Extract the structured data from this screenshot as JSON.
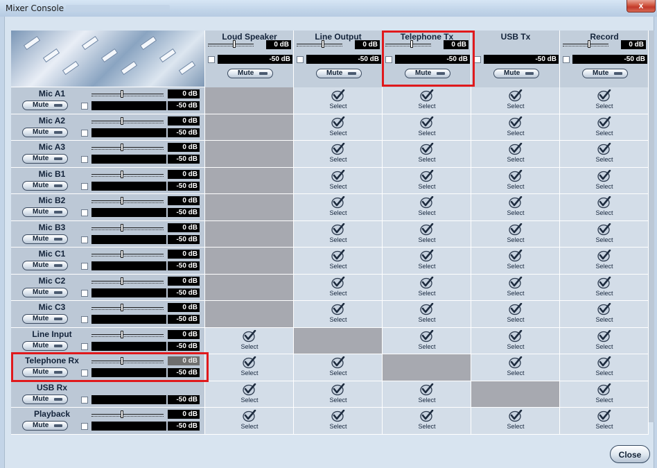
{
  "window": {
    "title": "Mixer Console",
    "close_glyph": "x"
  },
  "outputs": [
    {
      "name": "Loud Speaker",
      "gain": "0 dB",
      "level": "-50 dB",
      "mute": "Mute"
    },
    {
      "name": "Line Output",
      "gain": "0 dB",
      "level": "-50 dB",
      "mute": "Mute"
    },
    {
      "name": "Telephone Tx",
      "gain": "0 dB",
      "level": "-50 dB",
      "mute": "Mute"
    },
    {
      "name": "USB Tx",
      "gain": "",
      "level": "-50 dB",
      "mute": "Mute"
    },
    {
      "name": "Record",
      "gain": "0 dB",
      "level": "-50 dB",
      "mute": "Mute"
    }
  ],
  "inputs": [
    {
      "name": "Mic A1",
      "gain": "0 dB",
      "level": "-50 dB",
      "mute": "Mute"
    },
    {
      "name": "Mic A2",
      "gain": "0 dB",
      "level": "-50 dB",
      "mute": "Mute"
    },
    {
      "name": "Mic A3",
      "gain": "0 dB",
      "level": "-50 dB",
      "mute": "Mute"
    },
    {
      "name": "Mic B1",
      "gain": "0 dB",
      "level": "-50 dB",
      "mute": "Mute"
    },
    {
      "name": "Mic B2",
      "gain": "0 dB",
      "level": "-50 dB",
      "mute": "Mute"
    },
    {
      "name": "Mic B3",
      "gain": "0 dB",
      "level": "-50 dB",
      "mute": "Mute"
    },
    {
      "name": "Mic C1",
      "gain": "0 dB",
      "level": "-50 dB",
      "mute": "Mute"
    },
    {
      "name": "Mic C2",
      "gain": "0 dB",
      "level": "-50 dB",
      "mute": "Mute"
    },
    {
      "name": "Mic C3",
      "gain": "0 dB",
      "level": "-50 dB",
      "mute": "Mute"
    },
    {
      "name": "Line Input",
      "gain": "0 dB",
      "level": "-50 dB",
      "mute": "Mute"
    },
    {
      "name": "Telephone Rx",
      "gain": "0 dB",
      "level": "-50 dB",
      "mute": "Mute"
    },
    {
      "name": "USB Rx",
      "gain": "",
      "level": "-50 dB",
      "mute": "Mute"
    },
    {
      "name": "Playback",
      "gain": "0 dB",
      "level": "-50 dB",
      "mute": "Mute"
    }
  ],
  "routing": [
    [
      false,
      true,
      true,
      true,
      true
    ],
    [
      false,
      true,
      true,
      true,
      true
    ],
    [
      false,
      true,
      true,
      true,
      true
    ],
    [
      false,
      true,
      true,
      true,
      true
    ],
    [
      false,
      true,
      true,
      true,
      true
    ],
    [
      false,
      true,
      true,
      true,
      true
    ],
    [
      false,
      true,
      true,
      true,
      true
    ],
    [
      false,
      true,
      true,
      true,
      true
    ],
    [
      false,
      true,
      true,
      true,
      true
    ],
    [
      true,
      false,
      true,
      true,
      true
    ],
    [
      true,
      true,
      false,
      true,
      true
    ],
    [
      true,
      true,
      true,
      false,
      true
    ],
    [
      true,
      true,
      true,
      true,
      true
    ]
  ],
  "select_label": "Select",
  "close_button": "Close",
  "colors": {
    "highlight": "#e0191c",
    "disabled_cell": "#a7a9b0",
    "cell": "#d3dde8"
  }
}
